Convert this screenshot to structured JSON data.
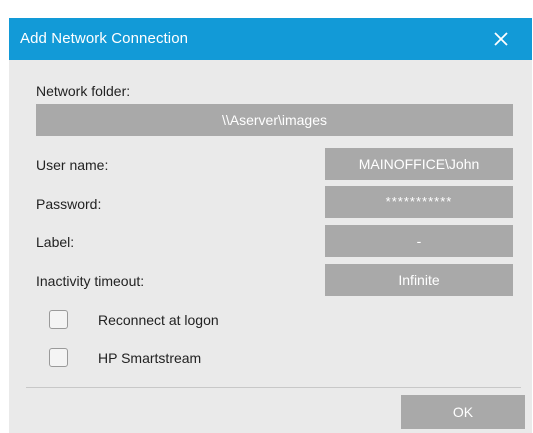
{
  "dialog": {
    "title": "Add Network Connection",
    "close_icon": "close-icon"
  },
  "form": {
    "network_folder": {
      "label": "Network folder:",
      "value": "\\\\Aserver\\images"
    },
    "user_name": {
      "label": "User name:",
      "value": "MAINOFFICE\\John"
    },
    "password": {
      "label": "Password:",
      "value": "***********"
    },
    "label_field": {
      "label": "Label:",
      "value": "-"
    },
    "inactivity_timeout": {
      "label": "Inactivity timeout:",
      "value": "Infinite"
    }
  },
  "options": {
    "reconnect": {
      "label": "Reconnect at logon",
      "checked": false
    },
    "smartstream": {
      "label": "HP Smartstream",
      "checked": false
    }
  },
  "footer": {
    "ok_label": "OK"
  },
  "colors": {
    "titlebar": "#129ad7",
    "dialog_background": "#eaeaea",
    "field_background": "#a9a9a9",
    "field_text": "#ffffff"
  }
}
